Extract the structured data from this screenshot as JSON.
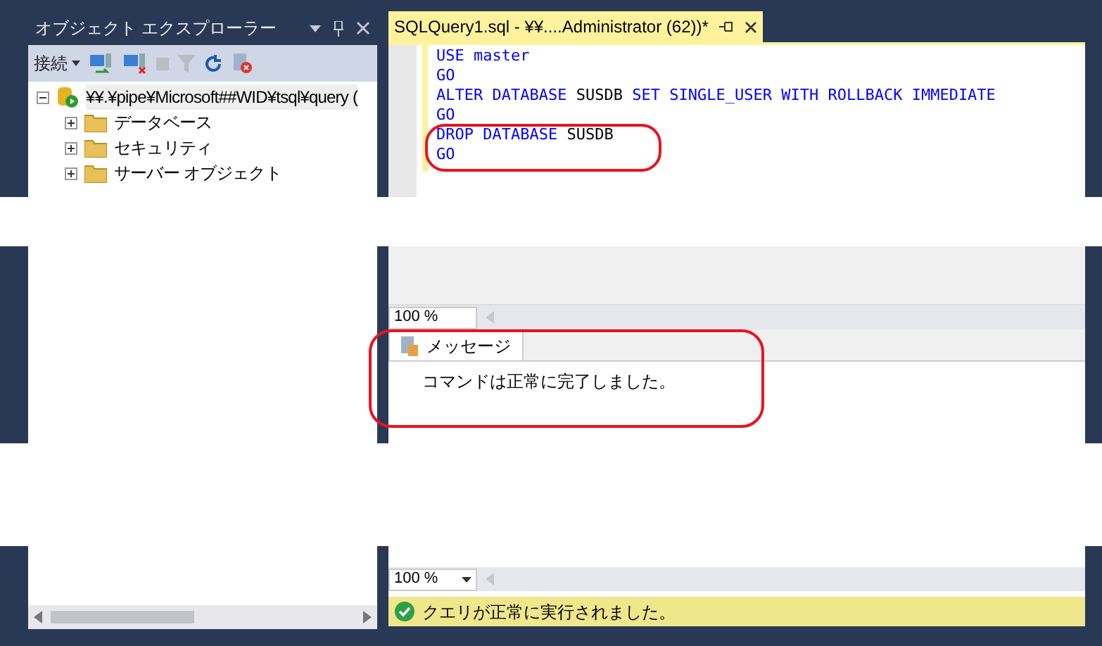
{
  "object_explorer": {
    "title": "オブジェクト エクスプローラー",
    "connect_label": "接続",
    "tree": [
      {
        "label": "¥¥.¥pipe¥Microsoft##WID¥tsql¥query (",
        "kind": "server",
        "expanded": true,
        "selected": true,
        "children": [
          {
            "label": "データベース",
            "kind": "folder",
            "expanded": false,
            "selected": false
          },
          {
            "label": "セキュリティ",
            "kind": "folder",
            "expanded": false,
            "selected": false
          },
          {
            "label": "サーバー オブジェクト",
            "kind": "folder",
            "expanded": false,
            "selected": false
          }
        ]
      }
    ]
  },
  "editor_tab": {
    "title": "SQLQuery1.sql - ¥¥....Administrator (62))*",
    "selected": true
  },
  "code_lines": [
    [
      {
        "text": "USE",
        "kind": "keyword"
      },
      {
        "text": "master",
        "kind": "keyword"
      }
    ],
    [
      {
        "text": "GO",
        "kind": "keyword"
      }
    ],
    [
      {
        "text": "ALTER",
        "kind": "keyword"
      },
      {
        "text": "DATABASE",
        "kind": "keyword"
      },
      {
        "text": "SUSDB",
        "kind": "identifier"
      },
      {
        "text": "SET",
        "kind": "keyword"
      },
      {
        "text": "SINGLE_USER",
        "kind": "keyword"
      },
      {
        "text": "WITH",
        "kind": "keyword"
      },
      {
        "text": "ROLLBACK",
        "kind": "keyword"
      },
      {
        "text": "IMMEDIATE",
        "kind": "keyword"
      }
    ],
    [
      {
        "text": "GO",
        "kind": "keyword"
      }
    ],
    [
      {
        "text": "DROP",
        "kind": "keyword"
      },
      {
        "text": "DATABASE",
        "kind": "keyword"
      },
      {
        "text": "SUSDB",
        "kind": "identifier"
      }
    ],
    [
      {
        "text": "GO",
        "kind": "keyword"
      }
    ]
  ],
  "editor_zoom": "100 %",
  "messages_tab": {
    "label": "メッセージ",
    "selected": true
  },
  "message": "コマンドは正常に完了しました。",
  "results_zoom": "100 %",
  "status": {
    "text": "クエリが正常に実行されました。",
    "kind": "success"
  }
}
